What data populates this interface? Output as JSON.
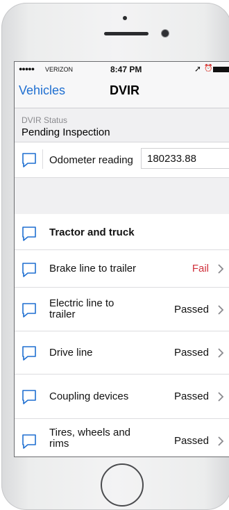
{
  "status_bar": {
    "signal": "●●●●●",
    "carrier": "VERIZON",
    "time": "8:47 PM",
    "location_icon": "location-arrow-icon",
    "alarm_icon": "alarm-icon",
    "battery_icon": "battery-icon"
  },
  "nav": {
    "back_label": "Vehicles",
    "title": "DVIR"
  },
  "dvir_status": {
    "label": "DVIR Status",
    "value": "Pending Inspection"
  },
  "odometer": {
    "label": "Odometer reading",
    "value": "180233.88"
  },
  "section": {
    "title": "Tractor and truck"
  },
  "items": [
    {
      "label_line1": "Brake line to trailer",
      "label_line2": "",
      "status": "Fail"
    },
    {
      "label_line1": "Electric line to",
      "label_line2": "trailer",
      "status": "Passed"
    },
    {
      "label_line1": "Drive line",
      "label_line2": "",
      "status": "Passed"
    },
    {
      "label_line1": "Coupling devices",
      "label_line2": "",
      "status": "Passed"
    },
    {
      "label_line1": "Tires, wheels and",
      "label_line2": "rims",
      "status": "Passed"
    }
  ],
  "colors": {
    "accent": "#1f6fd1",
    "fail": "#d0303c",
    "background": "#f0f0f2"
  }
}
